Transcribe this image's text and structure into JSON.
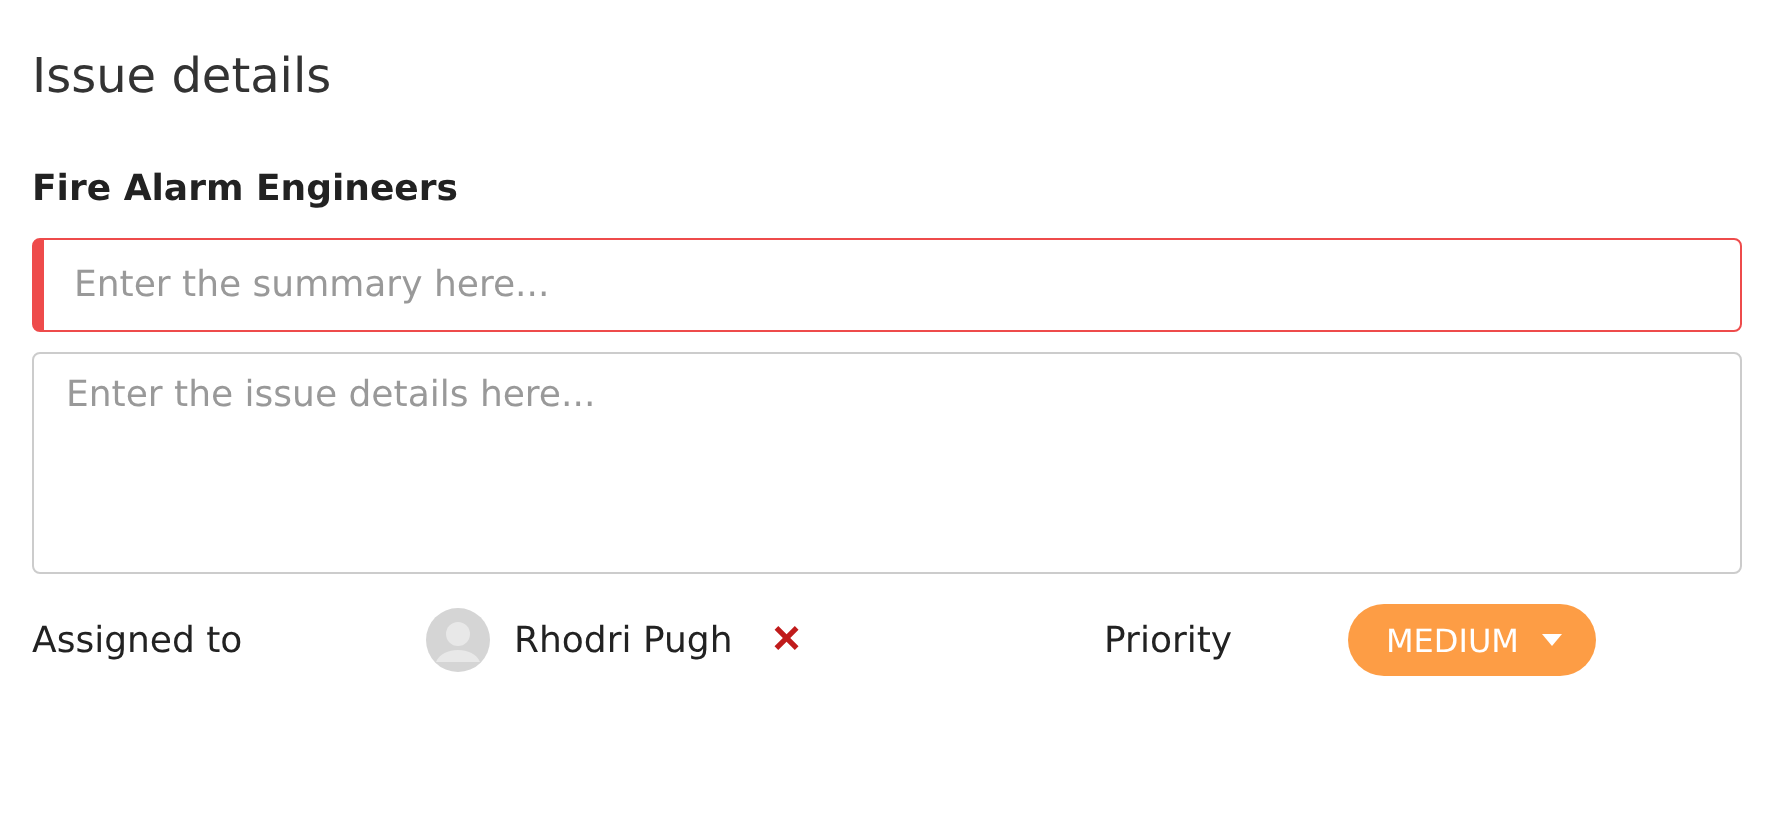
{
  "heading": "Issue details",
  "team": "Fire Alarm Engineers",
  "summary": {
    "placeholder": "Enter the summary here...",
    "invalid": true
  },
  "details": {
    "placeholder": "Enter the issue details here..."
  },
  "assignee": {
    "label": "Assigned to",
    "name": "Rhodri Pugh",
    "remove": "×"
  },
  "priority": {
    "label": "Priority",
    "value": "MEDIUM"
  }
}
